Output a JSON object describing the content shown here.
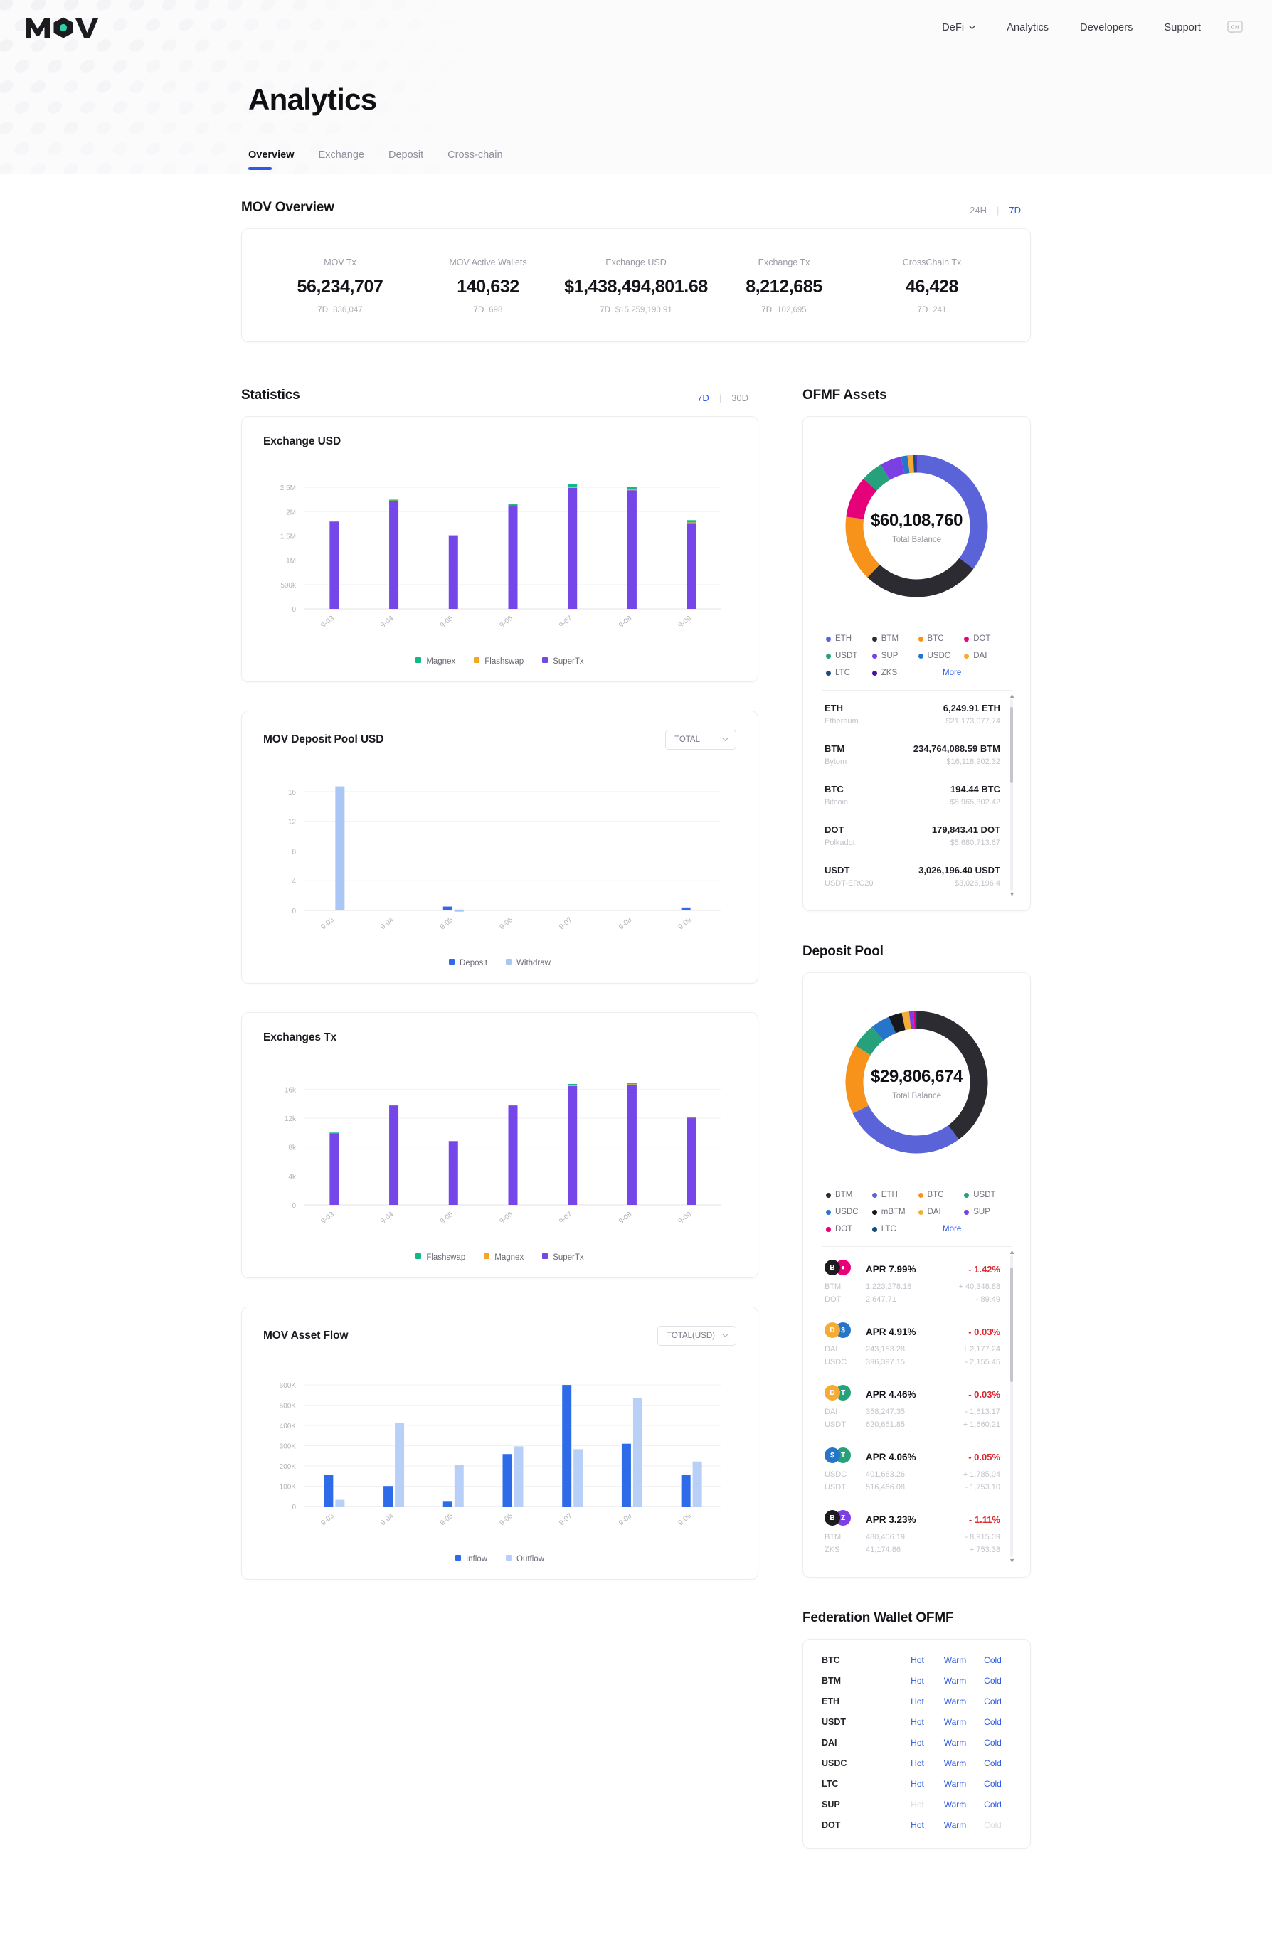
{
  "header": {
    "logo_text": "MOV",
    "nav": [
      {
        "label": "DeFi",
        "has_caret": true
      },
      {
        "label": "Analytics",
        "has_caret": false
      },
      {
        "label": "Developers",
        "has_caret": false
      },
      {
        "label": "Support",
        "has_caret": false
      }
    ],
    "language_badge": "CN"
  },
  "hero": {
    "title": "Analytics",
    "tabs": [
      {
        "label": "Overview",
        "active": true
      },
      {
        "label": "Exchange",
        "active": false
      },
      {
        "label": "Deposit",
        "active": false
      },
      {
        "label": "Cross-chain",
        "active": false
      }
    ]
  },
  "overview": {
    "title": "MOV Overview",
    "range": {
      "options": [
        "24H",
        "7D"
      ],
      "selected": "7D"
    },
    "stats": [
      {
        "label": "MOV Tx",
        "value": "56,234,707",
        "period": "7D",
        "delta": "836,047"
      },
      {
        "label": "MOV Active Wallets",
        "value": "140,632",
        "period": "7D",
        "delta": "698"
      },
      {
        "label": "Exchange USD",
        "value": "$1,438,494,801.68",
        "period": "7D",
        "delta": "$15,259,190.91"
      },
      {
        "label": "Exchange Tx",
        "value": "8,212,685",
        "period": "7D",
        "delta": "102,695"
      },
      {
        "label": "CrossChain Tx",
        "value": "46,428",
        "period": "7D",
        "delta": "241"
      }
    ]
  },
  "statistics": {
    "title": "Statistics",
    "range": {
      "options": [
        "7D",
        "30D"
      ],
      "selected": "7D"
    }
  },
  "chart_data": [
    {
      "type": "bar",
      "id": "exchange-usd",
      "title": "Exchange USD",
      "stacked": true,
      "categories": [
        "9-03",
        "9-04",
        "9-05",
        "9-06",
        "9-07",
        "9-08",
        "9-09"
      ],
      "series": [
        {
          "name": "SuperTx",
          "color": "#7546e8",
          "values": [
            1795000,
            2230000,
            1505000,
            2140000,
            2490000,
            2440000,
            1770000
          ]
        },
        {
          "name": "Flashswap",
          "color": "#f5a623",
          "values": [
            8000,
            10000,
            6000,
            9000,
            22000,
            28000,
            9000
          ]
        },
        {
          "name": "Magnex",
          "color": "#14b887",
          "values": [
            4000,
            6000,
            3000,
            6000,
            60000,
            42000,
            45000
          ]
        }
      ],
      "legend_order": [
        "Magnex",
        "Flashswap",
        "SuperTx"
      ],
      "ylabel": "",
      "xlabel": "",
      "ylim": [
        0,
        2750000
      ],
      "yticks": [
        0,
        500000,
        1000000,
        1500000,
        2000000,
        2500000
      ],
      "ytick_labels": [
        "0",
        "500k",
        "1M",
        "1.5M",
        "2M",
        "2.5M"
      ],
      "grid": true
    },
    {
      "type": "bar",
      "id": "mov-deposit-pool-usd",
      "title": "MOV Deposit Pool USD",
      "selector": {
        "value": "TOTAL",
        "options": [
          "TOTAL"
        ]
      },
      "grouped": true,
      "categories": [
        "9-03",
        "9-04",
        "9-05",
        "9-06",
        "9-07",
        "9-08",
        "9-09"
      ],
      "series": [
        {
          "name": "Deposit",
          "color": "#2d6be8",
          "values": [
            0,
            0,
            0.52,
            0,
            0,
            0,
            0.4
          ]
        },
        {
          "name": "Withdraw",
          "color": "#a9c6f5",
          "values": [
            16.7,
            0,
            0.12,
            0,
            0,
            0,
            0
          ]
        }
      ],
      "ylim": [
        0,
        18
      ],
      "yticks": [
        0,
        4,
        8,
        12,
        16
      ],
      "ytick_labels": [
        "0",
        "4",
        "8",
        "12",
        "16"
      ],
      "grid": true
    },
    {
      "type": "bar",
      "id": "exchanges-tx",
      "title": "Exchanges Tx",
      "stacked": true,
      "categories": [
        "9-03",
        "9-04",
        "9-05",
        "9-06",
        "9-07",
        "9-08",
        "9-09"
      ],
      "series": [
        {
          "name": "SuperTx",
          "color": "#7546e8",
          "values": [
            9950,
            13800,
            8800,
            13800,
            16450,
            16650,
            12050
          ]
        },
        {
          "name": "Magnex",
          "color": "#f5a623",
          "values": [
            40,
            30,
            25,
            30,
            170,
            130,
            60
          ]
        },
        {
          "name": "Flashswap",
          "color": "#14b887",
          "values": [
            20,
            15,
            10,
            15,
            110,
            40,
            25
          ]
        }
      ],
      "legend_order": [
        "Flashswap",
        "Magnex",
        "SuperTx"
      ],
      "ylim": [
        0,
        18500
      ],
      "yticks": [
        0,
        4000,
        8000,
        12000,
        16000
      ],
      "ytick_labels": [
        "0",
        "4k",
        "8k",
        "12k",
        "16k"
      ],
      "grid": true
    },
    {
      "type": "bar",
      "id": "mov-asset-flow",
      "title": "MOV Asset Flow",
      "selector": {
        "value": "TOTAL(USD)",
        "options": [
          "TOTAL(USD)"
        ]
      },
      "grouped": true,
      "categories": [
        "9-03",
        "9-04",
        "9-05",
        "9-06",
        "9-07",
        "9-08",
        "9-09"
      ],
      "series": [
        {
          "name": "Inflow",
          "color": "#2d6be8",
          "values": [
            155000,
            101000,
            27000,
            259000,
            600000,
            310000,
            158000
          ]
        },
        {
          "name": "Outflow",
          "color": "#b8d0f7",
          "values": [
            33000,
            412000,
            207000,
            297000,
            283000,
            537000,
            222000
          ]
        }
      ],
      "ylim": [
        0,
        660000
      ],
      "yticks": [
        0,
        100000,
        200000,
        300000,
        400000,
        500000,
        600000
      ],
      "ytick_labels": [
        "0",
        "100K",
        "200K",
        "300K",
        "400K",
        "500K",
        "600K"
      ],
      "grid": true
    },
    {
      "type": "pie",
      "id": "ofmf-assets-donut",
      "title": "OFMF Assets",
      "center_value": "$60,108,760",
      "center_label": "Total Balance",
      "slices": [
        {
          "name": "ETH",
          "color": "#5a63d8",
          "value": 21173077.74
        },
        {
          "name": "BTM",
          "color": "#2b2b31",
          "value": 16118902.32
        },
        {
          "name": "BTC",
          "color": "#f7931a",
          "value": 8965302.42
        },
        {
          "name": "DOT",
          "color": "#e6007a",
          "value": 5680713.67
        },
        {
          "name": "USDT",
          "color": "#26a17b",
          "value": 3026196.4
        },
        {
          "name": "SUP",
          "color": "#7b3fe4",
          "value": 2900000
        },
        {
          "name": "USDC",
          "color": "#2775ca",
          "value": 900000
        },
        {
          "name": "DAI",
          "color": "#f5ac37",
          "value": 780000
        },
        {
          "name": "LTC",
          "color": "#1b4c7a",
          "value": 310000
        },
        {
          "name": "ZKS",
          "color": "#4b0f9e",
          "value": 160000
        }
      ],
      "legend": [
        "ETH",
        "BTM",
        "BTC",
        "DOT",
        "USDT",
        "SUP",
        "USDC",
        "DAI",
        "LTC",
        "ZKS"
      ],
      "more_label": "More"
    },
    {
      "type": "pie",
      "id": "deposit-pool-donut",
      "title": "Deposit Pool",
      "center_value": "$29,806,674",
      "center_label": "Total Balance",
      "slices": [
        {
          "name": "BTM",
          "color": "#2b2b31",
          "value": 11900000
        },
        {
          "name": "ETH",
          "color": "#5a63d8",
          "value": 8300000
        },
        {
          "name": "BTC",
          "color": "#f7931a",
          "value": 4700000
        },
        {
          "name": "USDT",
          "color": "#26a17b",
          "value": 1700000
        },
        {
          "name": "USDC",
          "color": "#2775ca",
          "value": 1300000
        },
        {
          "name": "mBTM",
          "color": "#18181c",
          "value": 900000
        },
        {
          "name": "DAI",
          "color": "#f5ac37",
          "value": 500000
        },
        {
          "name": "SUP",
          "color": "#7b3fe4",
          "value": 300000
        },
        {
          "name": "DOT",
          "color": "#e6007a",
          "value": 160000
        },
        {
          "name": "LTC",
          "color": "#1b4c7a",
          "value": 46674
        }
      ],
      "legend": [
        "BTM",
        "ETH",
        "BTC",
        "USDT",
        "USDC",
        "mBTM",
        "DAI",
        "SUP",
        "DOT",
        "LTC"
      ],
      "more_label": "More"
    }
  ],
  "ofmf_assets": {
    "title": "OFMF Assets",
    "assets": [
      {
        "symbol": "ETH",
        "name": "Ethereum",
        "amount": "6,249.91 ETH",
        "usd": "$21,173,077.74"
      },
      {
        "symbol": "BTM",
        "name": "Bytom",
        "amount": "234,764,088.59 BTM",
        "usd": "$16,118,902.32"
      },
      {
        "symbol": "BTC",
        "name": "Bitcoin",
        "amount": "194.44 BTC",
        "usd": "$8,965,302.42"
      },
      {
        "symbol": "DOT",
        "name": "Polkadot",
        "amount": "179,843.41 DOT",
        "usd": "$5,680,713.67"
      },
      {
        "symbol": "USDT",
        "name": "USDT-ERC20",
        "amount": "3,026,196.40 USDT",
        "usd": "$3,026,196.4"
      }
    ]
  },
  "deposit_pool": {
    "title": "Deposit Pool",
    "pools": [
      {
        "coin1": {
          "symbol": "BTM",
          "glyph": "Ƀ",
          "color": "#1c1c20"
        },
        "coin2": {
          "symbol": "DOT",
          "glyph": "●",
          "color": "#e6007a"
        },
        "apr": "APR 7.99%",
        "delta": "- 1.42%",
        "rows": [
          {
            "k": "BTM",
            "v": "1,223,278.18",
            "d": "+ 40,348.88"
          },
          {
            "k": "DOT",
            "v": "2,647.71",
            "d": "- 89.49"
          }
        ]
      },
      {
        "coin1": {
          "symbol": "DAI",
          "glyph": "D",
          "color": "#f5ac37"
        },
        "coin2": {
          "symbol": "USDC",
          "glyph": "$",
          "color": "#2775ca"
        },
        "apr": "APR 4.91%",
        "delta": "- 0.03%",
        "rows": [
          {
            "k": "DAI",
            "v": "243,153.28",
            "d": "+ 2,177.24"
          },
          {
            "k": "USDC",
            "v": "396,397.15",
            "d": "- 2,155.45"
          }
        ]
      },
      {
        "coin1": {
          "symbol": "DAI",
          "glyph": "D",
          "color": "#f5ac37"
        },
        "coin2": {
          "symbol": "USDT",
          "glyph": "T",
          "color": "#26a17b"
        },
        "apr": "APR 4.46%",
        "delta": "- 0.03%",
        "rows": [
          {
            "k": "DAI",
            "v": "358,247.35",
            "d": "- 1,613.17"
          },
          {
            "k": "USDT",
            "v": "620,651.85",
            "d": "+ 1,660.21"
          }
        ]
      },
      {
        "coin1": {
          "symbol": "USDC",
          "glyph": "$",
          "color": "#2775ca"
        },
        "coin2": {
          "symbol": "USDT",
          "glyph": "T",
          "color": "#26a17b"
        },
        "apr": "APR 4.06%",
        "delta": "- 0.05%",
        "rows": [
          {
            "k": "USDC",
            "v": "401,663.26",
            "d": "+ 1,785.04"
          },
          {
            "k": "USDT",
            "v": "516,466.08",
            "d": "- 1,753.10"
          }
        ]
      },
      {
        "coin1": {
          "symbol": "BTM",
          "glyph": "Ƀ",
          "color": "#1c1c20"
        },
        "coin2": {
          "symbol": "ZKS",
          "glyph": "Z",
          "color": "#7b3fe4"
        },
        "apr": "APR 3.23%",
        "delta": "- 1.11%",
        "rows": [
          {
            "k": "BTM",
            "v": "480,406.19",
            "d": "- 8,915.09"
          },
          {
            "k": "ZKS",
            "v": "41,174.86",
            "d": "+ 753.38"
          }
        ]
      }
    ]
  },
  "federation_wallet": {
    "title": "Federation Wallet OFMF",
    "links": [
      "Hot",
      "Warm",
      "Cold"
    ],
    "rows": [
      {
        "symbol": "BTC",
        "hot": true,
        "warm": true,
        "cold": true
      },
      {
        "symbol": "BTM",
        "hot": true,
        "warm": true,
        "cold": true
      },
      {
        "symbol": "ETH",
        "hot": true,
        "warm": true,
        "cold": true
      },
      {
        "symbol": "USDT",
        "hot": true,
        "warm": true,
        "cold": true
      },
      {
        "symbol": "DAI",
        "hot": true,
        "warm": true,
        "cold": true
      },
      {
        "symbol": "USDC",
        "hot": true,
        "warm": true,
        "cold": true
      },
      {
        "symbol": "LTC",
        "hot": true,
        "warm": true,
        "cold": true
      },
      {
        "symbol": "SUP",
        "hot": false,
        "warm": true,
        "cold": true
      },
      {
        "symbol": "DOT",
        "hot": true,
        "warm": true,
        "cold": false
      }
    ]
  },
  "colors": {
    "accent": "#2d5be3",
    "purple": "#7546e8",
    "green": "#14b887",
    "orange": "#f5a623",
    "blue_dark": "#2d6be8",
    "blue_light": "#b8d0f7",
    "red": "#e0262f"
  }
}
